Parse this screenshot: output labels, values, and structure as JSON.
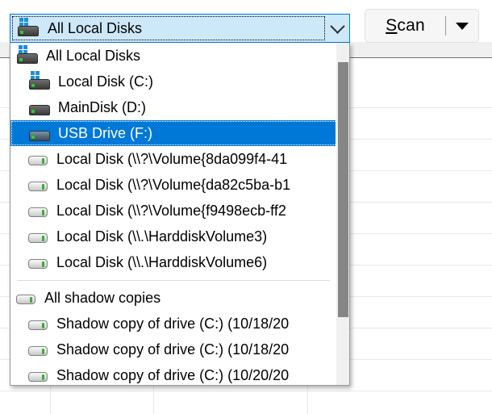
{
  "toolbar": {
    "combo": {
      "selected_value": "All Local Disks",
      "icon": "drive-windows-icon",
      "arrow_icon": "chevron-down-icon"
    },
    "scan_button": {
      "accel_letter": "S",
      "rest_label": "can",
      "full_label": "Scan",
      "arrow_icon": "triangle-down-icon"
    }
  },
  "dropdown": {
    "scrollbar": {
      "name": "vertical-scrollbar",
      "thumb": "scroll-thumb"
    },
    "items": [
      {
        "label": "All Local Disks",
        "icon": "drive-windows-icon",
        "style": "dark-windows",
        "indent": 0,
        "selected": false
      },
      {
        "label": "Local Disk (C:)",
        "icon": "drive-windows-icon",
        "style": "dark-windows",
        "indent": 1,
        "selected": false
      },
      {
        "label": "MainDisk (D:)",
        "icon": "drive-icon",
        "style": "dark",
        "indent": 1,
        "selected": false
      },
      {
        "label": "USB Drive (F:)",
        "icon": "usb-drive-icon",
        "style": "usb",
        "indent": 1,
        "selected": true
      },
      {
        "label": "Local Disk (\\\\?\\Volume{8da099f4-41",
        "icon": "volume-icon",
        "style": "light",
        "indent": 1,
        "selected": false
      },
      {
        "label": "Local Disk (\\\\?\\Volume{da82c5ba-b1",
        "icon": "volume-icon",
        "style": "light",
        "indent": 1,
        "selected": false
      },
      {
        "label": "Local Disk (\\\\?\\Volume{f9498ecb-ff2",
        "icon": "volume-icon",
        "style": "light",
        "indent": 1,
        "selected": false
      },
      {
        "label": "Local Disk (\\\\.\\HarddiskVolume3)",
        "icon": "volume-icon",
        "style": "light",
        "indent": 1,
        "selected": false
      },
      {
        "label": "Local Disk (\\\\.\\HarddiskVolume6)",
        "icon": "volume-icon",
        "style": "light",
        "indent": 1,
        "selected": false
      },
      {
        "separator": true
      },
      {
        "label": "All shadow copies",
        "icon": "shadow-copy-icon",
        "style": "light",
        "indent": 0,
        "selected": false
      },
      {
        "label": "Shadow copy of drive (C:) (10/18/20",
        "icon": "shadow-copy-icon",
        "style": "light",
        "indent": 1,
        "selected": false
      },
      {
        "label": "Shadow copy of drive (C:) (10/18/20",
        "icon": "shadow-copy-icon",
        "style": "light",
        "indent": 1,
        "selected": false
      },
      {
        "label": "Shadow copy of drive (C:) (10/20/20",
        "icon": "shadow-copy-icon",
        "style": "light",
        "indent": 1,
        "selected": false
      }
    ]
  },
  "colors": {
    "selection_blue": "#0078d7",
    "combo_fill": "#cde8f9",
    "scrollbar_thumb": "#868686",
    "drive_led_green": "#2ecc2e",
    "windows_flag_blue": "#1e8fd5"
  }
}
